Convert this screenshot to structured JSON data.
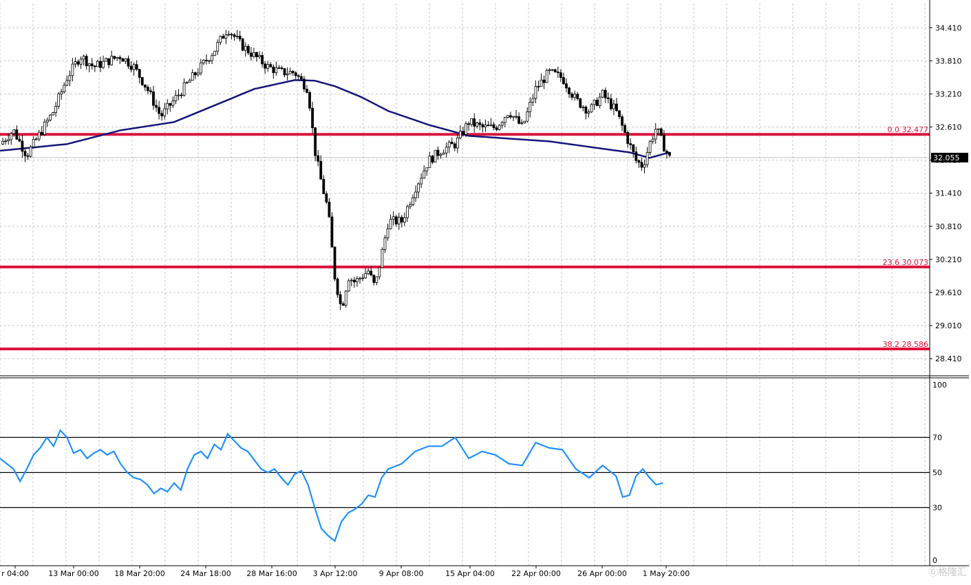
{
  "chart_data": [
    {
      "type": "candlestick",
      "title": "",
      "grid": true,
      "ylim": [
        28.1,
        34.85
      ],
      "y_ticks": [
        "34.410",
        "33.810",
        "33.210",
        "32.610",
        "32.010",
        "31.410",
        "30.810",
        "30.210",
        "29.610",
        "29.010",
        "28.410"
      ],
      "x_ticks": [
        "r 04:00",
        "13 Mar 00:00",
        "18 Mar 20:00",
        "24 Mar 18:00",
        "28 Mar 16:00",
        "3 Apr 12:00",
        "9 Apr 08:00",
        "15 Apr 04:00",
        "22 Apr 00:00",
        "26 Apr 00:00",
        "1 May 20:00"
      ],
      "current_price": "32.055",
      "fib_levels": [
        {
          "label": "0.0 32.477",
          "value": 32.477
        },
        {
          "label": "23.6 30.073",
          "value": 30.073
        },
        {
          "label": "38.2 28.586",
          "value": 28.586
        }
      ],
      "price_path": [
        [
          0,
          32.3
        ],
        [
          2,
          32.55
        ],
        [
          4,
          32.1
        ],
        [
          6,
          32.5
        ],
        [
          8,
          32.9
        ],
        [
          10,
          33.5
        ],
        [
          12,
          33.9
        ],
        [
          14,
          33.7
        ],
        [
          16,
          33.8
        ],
        [
          18,
          33.9
        ],
        [
          20,
          33.7
        ],
        [
          22,
          33.3
        ],
        [
          24,
          32.8
        ],
        [
          26,
          33.1
        ],
        [
          28,
          33.4
        ],
        [
          30,
          33.7
        ],
        [
          32,
          34.0
        ],
        [
          34,
          34.4
        ],
        [
          36,
          34.1
        ],
        [
          38,
          33.9
        ],
        [
          40,
          33.7
        ],
        [
          42,
          33.6
        ],
        [
          44,
          33.6
        ],
        [
          46,
          33.3
        ],
        [
          47,
          32.2
        ],
        [
          48,
          31.6
        ],
        [
          49,
          31.1
        ],
        [
          50,
          29.9
        ],
        [
          51,
          29.3
        ],
        [
          52,
          29.9
        ],
        [
          53,
          29.8
        ],
        [
          54,
          29.9
        ],
        [
          55,
          30.0
        ],
        [
          56,
          29.7
        ],
        [
          57,
          30.3
        ],
        [
          58,
          30.9
        ],
        [
          60,
          30.9
        ],
        [
          62,
          31.5
        ],
        [
          64,
          32.0
        ],
        [
          66,
          32.2
        ],
        [
          68,
          32.3
        ],
        [
          70,
          32.7
        ],
        [
          72,
          32.6
        ],
        [
          74,
          32.6
        ],
        [
          76,
          32.9
        ],
        [
          78,
          32.6
        ],
        [
          80,
          33.3
        ],
        [
          82,
          33.6
        ],
        [
          84,
          33.5
        ],
        [
          86,
          33.1
        ],
        [
          88,
          32.9
        ],
        [
          90,
          33.2
        ],
        [
          92,
          32.9
        ],
        [
          93,
          32.6
        ],
        [
          94,
          32.3
        ],
        [
          95,
          32.0
        ],
        [
          96,
          31.9
        ],
        [
          97,
          32.3
        ],
        [
          98,
          32.6
        ],
        [
          99,
          32.3
        ],
        [
          100,
          32.05
        ]
      ],
      "moving_average_path": [
        [
          0,
          32.18
        ],
        [
          10,
          32.3
        ],
        [
          18,
          32.55
        ],
        [
          26,
          32.7
        ],
        [
          32,
          33.0
        ],
        [
          38,
          33.3
        ],
        [
          44,
          33.46
        ],
        [
          47,
          33.45
        ],
        [
          50,
          33.35
        ],
        [
          54,
          33.15
        ],
        [
          58,
          32.9
        ],
        [
          64,
          32.65
        ],
        [
          70,
          32.45
        ],
        [
          76,
          32.4
        ],
        [
          82,
          32.35
        ],
        [
          88,
          32.25
        ],
        [
          94,
          32.15
        ],
        [
          97,
          32.05
        ],
        [
          100,
          32.15
        ]
      ]
    },
    {
      "type": "line",
      "title": "",
      "ylim": [
        0,
        100
      ],
      "y_ticks": [
        "100",
        "70",
        "50",
        "30",
        "0"
      ],
      "levels": [
        70,
        50,
        30
      ],
      "series": [
        {
          "color": "#1e90ff",
          "points": [
            [
              0,
              58
            ],
            [
              2,
              52
            ],
            [
              3,
              45
            ],
            [
              4,
              52
            ],
            [
              5,
              60
            ],
            [
              6,
              64
            ],
            [
              7,
              70
            ],
            [
              8,
              65
            ],
            [
              9,
              74
            ],
            [
              10,
              70
            ],
            [
              11,
              61
            ],
            [
              12,
              63
            ],
            [
              13,
              58
            ],
            [
              14,
              61
            ],
            [
              15,
              63
            ],
            [
              16,
              60
            ],
            [
              17,
              62
            ],
            [
              18,
              55
            ],
            [
              19,
              50
            ],
            [
              20,
              47
            ],
            [
              21,
              46
            ],
            [
              22,
              43
            ],
            [
              23,
              38
            ],
            [
              24,
              41
            ],
            [
              25,
              39
            ],
            [
              26,
              44
            ],
            [
              27,
              40
            ],
            [
              28,
              52
            ],
            [
              29,
              60
            ],
            [
              30,
              62
            ],
            [
              31,
              58
            ],
            [
              32,
              66
            ],
            [
              33,
              63
            ],
            [
              34,
              72
            ],
            [
              35,
              68
            ],
            [
              36,
              64
            ],
            [
              37,
              62
            ],
            [
              38,
              57
            ],
            [
              39,
              52
            ],
            [
              40,
              50
            ],
            [
              41,
              52
            ],
            [
              42,
              47
            ],
            [
              43,
              43
            ],
            [
              44,
              49
            ],
            [
              45,
              51
            ],
            [
              46,
              43
            ],
            [
              47,
              30
            ],
            [
              48,
              18
            ],
            [
              49,
              14
            ],
            [
              50,
              11
            ],
            [
              51,
              22
            ],
            [
              52,
              27
            ],
            [
              53,
              29
            ],
            [
              54,
              32
            ],
            [
              55,
              37
            ],
            [
              56,
              36
            ],
            [
              57,
              47
            ],
            [
              58,
              52
            ],
            [
              60,
              55
            ],
            [
              62,
              62
            ],
            [
              64,
              65
            ],
            [
              66,
              65
            ],
            [
              68,
              70
            ],
            [
              70,
              58
            ],
            [
              72,
              62
            ],
            [
              74,
              60
            ],
            [
              76,
              55
            ],
            [
              78,
              54
            ],
            [
              80,
              67
            ],
            [
              82,
              64
            ],
            [
              84,
              63
            ],
            [
              86,
              52
            ],
            [
              88,
              47
            ],
            [
              90,
              54
            ],
            [
              92,
              48
            ],
            [
              93,
              36
            ],
            [
              94,
              37
            ],
            [
              95,
              48
            ],
            [
              96,
              52
            ],
            [
              97,
              47
            ],
            [
              98,
              43
            ],
            [
              99,
              44
            ]
          ]
        }
      ]
    }
  ],
  "watermark": "Ⓖ格隆汇"
}
